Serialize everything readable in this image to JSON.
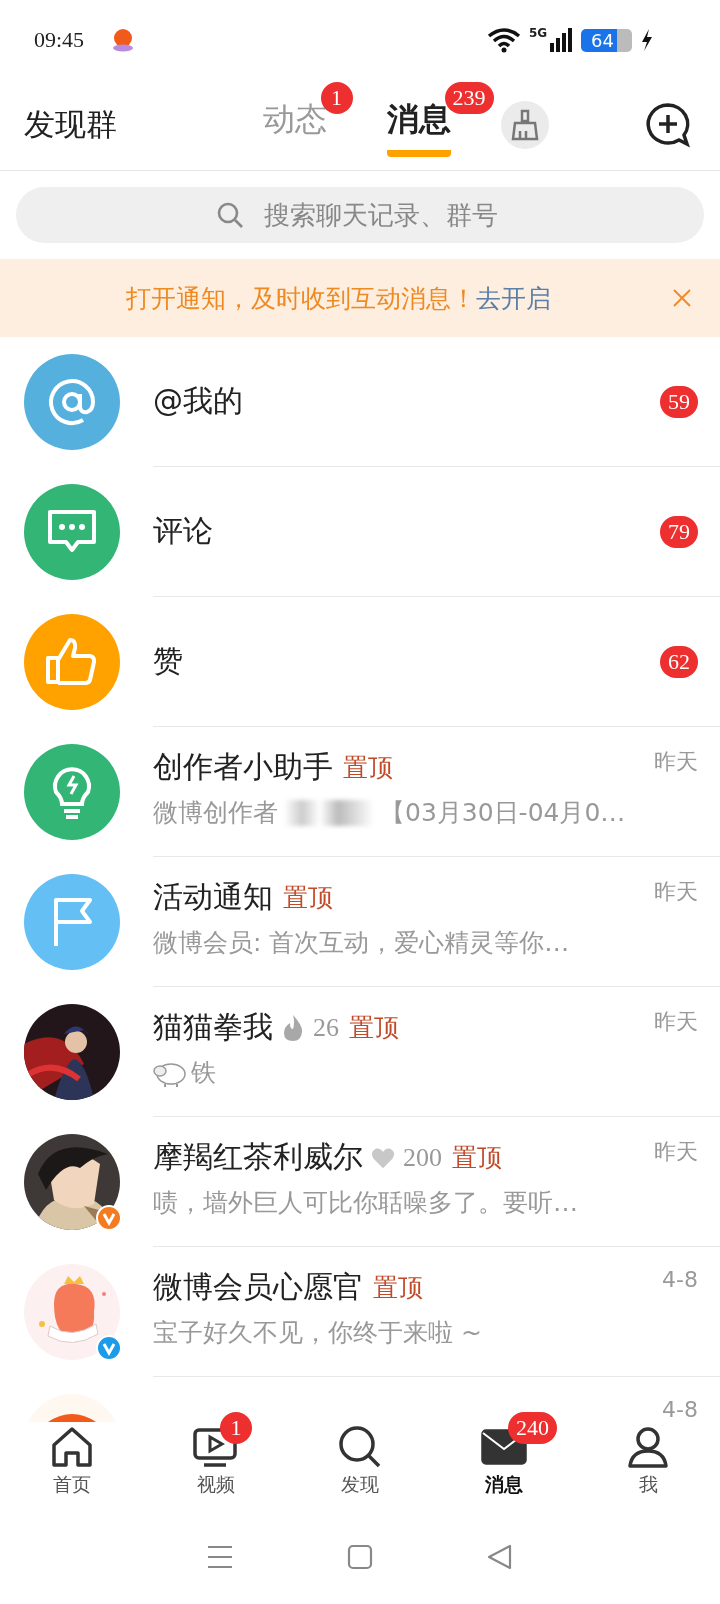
{
  "status_bar": {
    "time": "09:45",
    "network": "5G",
    "battery": "64"
  },
  "header": {
    "left": "发现群",
    "tabs": [
      {
        "label": "动态",
        "badge": "1",
        "selected": false
      },
      {
        "label": "消息",
        "badge": "239",
        "selected": true
      }
    ]
  },
  "search": {
    "placeholder": "搜索聊天记录、群号"
  },
  "notice_banner": {
    "text": "打开通知，及时收到互动消息！",
    "action": "去开启"
  },
  "rows": [
    {
      "kind": "mention",
      "color": "#56b0dd",
      "title": "@我的",
      "count": "59"
    },
    {
      "kind": "comment",
      "color": "#33b576",
      "title": "评论",
      "count": "79"
    },
    {
      "kind": "like",
      "color": "#ffa200",
      "title": "赞",
      "count": "62"
    },
    {
      "kind": "assistant",
      "color": "#33b576",
      "title": "创作者小助手",
      "pinned": "置顶",
      "time": "昨天",
      "preview": "微博创作者",
      "redacted": true,
      "preview_rest": "【03月30日-04月0…"
    },
    {
      "kind": "notice",
      "color": "#64bff5",
      "title": "活动通知",
      "pinned": "置顶",
      "time": "昨天",
      "preview": "微博会员: 首次互动，爱心精灵等你…"
    },
    {
      "kind": "chat",
      "title": "猫猫拳我",
      "intimacy": {
        "kind": "fire",
        "value": "26"
      },
      "pinned": "置顶",
      "time": "昨天",
      "sticker": true,
      "preview": "铁"
    },
    {
      "kind": "chat",
      "title": "摩羯红茶利威尔",
      "intimacy": {
        "kind": "heart",
        "value": "200"
      },
      "pinned": "置顶",
      "time": "昨天",
      "preview": "啧，墙外巨人可比你聒噪多了。要听…",
      "verified": {
        "color": "#f47b20"
      }
    },
    {
      "kind": "chat",
      "title": "微博会员心愿官",
      "pinned": "置顶",
      "time": "4-8",
      "preview": "宝子好久不见，你终于来啦 ~",
      "verified": {
        "color": "#1e9be8"
      }
    },
    {
      "kind": "chat",
      "time": "4-8"
    }
  ],
  "bottom_nav": [
    {
      "kind": "home",
      "label": "首页",
      "selected": false
    },
    {
      "kind": "video",
      "label": "视频",
      "badge": "1",
      "selected": false
    },
    {
      "kind": "discover",
      "label": "发现",
      "selected": false
    },
    {
      "kind": "message",
      "label": "消息",
      "badge": "240",
      "selected": true
    },
    {
      "kind": "profile",
      "label": "我",
      "selected": false
    }
  ]
}
